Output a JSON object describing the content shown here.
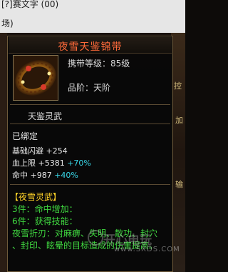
{
  "window": {
    "title_fragment": "[?]赛文字 (00)",
    "subtitle_fragment": "场)"
  },
  "side_text": [
    "控",
    "加",
    "输"
  ],
  "tooltip": {
    "title": "夜雪天鉴锦带",
    "level_label": "携带等级：85级",
    "grade_label": "品阶：天阶",
    "item_icon": "golden-belt-icon",
    "spirit_label": "天鉴灵武",
    "bound_status": "已绑定",
    "stats": [
      {
        "name": "基础闪避",
        "base": "+254",
        "bonus": ""
      },
      {
        "name": "血上限",
        "base": "+5381",
        "bonus": "+70%"
      },
      {
        "name": "命中",
        "base": "+987",
        "bonus": "+40%"
      }
    ],
    "set": {
      "name": "【夜雪灵武】",
      "lines": [
        "3件：命中增加：",
        "6件：获得技能：",
        "夜雪折刃：对麻痹、失明、散功、封穴",
        "、封印、眩晕的目标造成的伤害提高。"
      ]
    },
    "colors": {
      "title": "#ff6a3a",
      "bonus": "#39d8e8",
      "set_name": "#ffd228",
      "set_text": "#40d840"
    }
  },
  "watermark": {
    "text": "开心电玩",
    "url": "www.SXDS.COM"
  }
}
